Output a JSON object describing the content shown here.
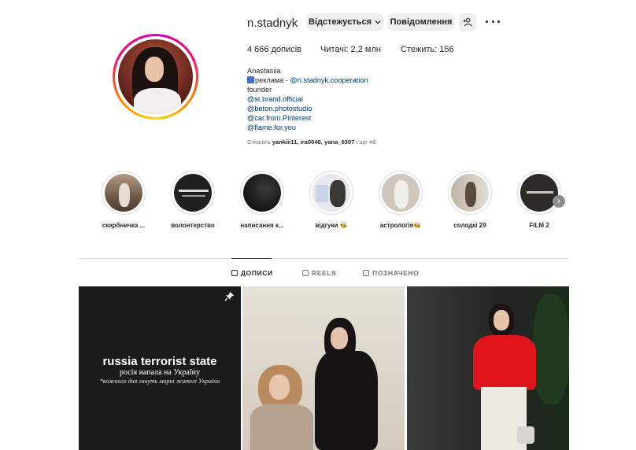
{
  "profile": {
    "username": "n.stadnyk",
    "follow_button": "Відстежується",
    "message_button": "Повідомлення",
    "posts_count": "4 666 дописів",
    "followers": "Читачі: 2,2 млн",
    "following": "Стежить: 156"
  },
  "bio": {
    "name": "Anastasiia",
    "ad_prefix": "реклама - ",
    "ad_link": "@n.stadnyk.cooperation",
    "role": "founder",
    "links": [
      "@st.brand.official",
      "@beton.photostudio",
      "@car.from.Pinterest",
      "@flame.for.you"
    ]
  },
  "followed_by": {
    "prefix": "Стежать ",
    "names": "yankiii11, ira0040, yana_0307",
    "suffix": " і ще 46"
  },
  "highlights": [
    {
      "label": "скарбничка ..."
    },
    {
      "label": "волонтерство"
    },
    {
      "label": "написання к..."
    },
    {
      "label": "відгуки 🐝"
    },
    {
      "label": "астрологія🐝"
    },
    {
      "label": "солодкі 29"
    },
    {
      "label": "FILM 2"
    }
  ],
  "tabs": [
    {
      "label": "ДОПИСИ",
      "active": true
    },
    {
      "label": "REELS",
      "active": false
    },
    {
      "label": "ПОЗНАЧЕНО",
      "active": false
    }
  ],
  "posts": {
    "first": {
      "title": "russia terrorist state",
      "line1": "росія напала на Україну",
      "line2": "*кожного дня гинуть мирні жителі України"
    }
  },
  "colors": {
    "accent_link": "#00376b",
    "button_bg": "#efefef",
    "divider": "#dbdbdb"
  }
}
